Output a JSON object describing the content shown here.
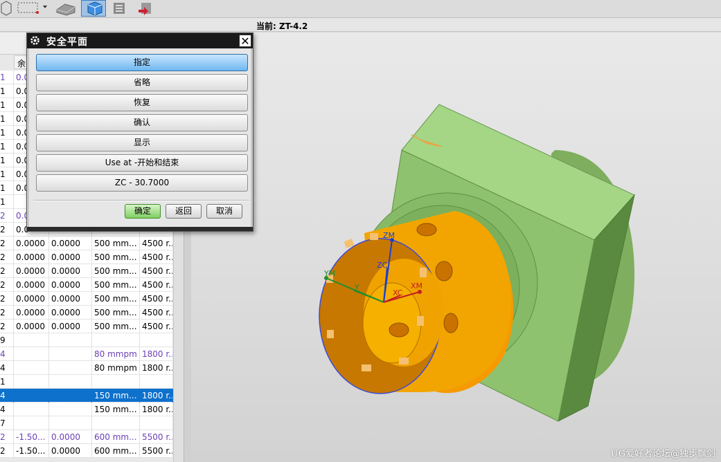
{
  "status": {
    "current_label": "当前: ZT-4.2"
  },
  "navigator": {
    "column_header": "余",
    "rows": [
      {
        "c0": "1",
        "c1": "0.0",
        "c2": "",
        "c3": "",
        "c4": "",
        "style": "purple"
      },
      {
        "c0": "1",
        "c1": "0.0",
        "c2": "",
        "c3": "",
        "c4": "",
        "style": ""
      },
      {
        "c0": "1",
        "c1": "0.0",
        "c2": "",
        "c3": "",
        "c4": "",
        "style": ""
      },
      {
        "c0": "1",
        "c1": "0.0",
        "c2": "",
        "c3": "",
        "c4": "",
        "style": ""
      },
      {
        "c0": "1",
        "c1": "0.0",
        "c2": "",
        "c3": "",
        "c4": "",
        "style": ""
      },
      {
        "c0": "1",
        "c1": "0.0",
        "c2": "",
        "c3": "",
        "c4": "",
        "style": ""
      },
      {
        "c0": "1",
        "c1": "0.0",
        "c2": "",
        "c3": "",
        "c4": "",
        "style": ""
      },
      {
        "c0": "1",
        "c1": "0.0",
        "c2": "",
        "c3": "",
        "c4": "",
        "style": ""
      },
      {
        "c0": "1",
        "c1": "0.0",
        "c2": "",
        "c3": "",
        "c4": "",
        "style": ""
      },
      {
        "c0": "1",
        "c1": "",
        "c2": "",
        "c3": "",
        "c4": "",
        "style": ""
      },
      {
        "c0": "2",
        "c1": "0.0",
        "c2": "",
        "c3": "",
        "c4": "",
        "style": "purple"
      },
      {
        "c0": "2",
        "c1": "0.0",
        "c2": "",
        "c3": "",
        "c4": "",
        "style": ""
      },
      {
        "c0": "2",
        "c1": "0.0000",
        "c2": "0.0000",
        "c3": "500 mm...",
        "c4": "4500 r...",
        "style": ""
      },
      {
        "c0": "2",
        "c1": "0.0000",
        "c2": "0.0000",
        "c3": "500 mm...",
        "c4": "4500 r...",
        "style": ""
      },
      {
        "c0": "2",
        "c1": "0.0000",
        "c2": "0.0000",
        "c3": "500 mm...",
        "c4": "4500 r...",
        "style": ""
      },
      {
        "c0": "2",
        "c1": "0.0000",
        "c2": "0.0000",
        "c3": "500 mm...",
        "c4": "4500 r...",
        "style": ""
      },
      {
        "c0": "2",
        "c1": "0.0000",
        "c2": "0.0000",
        "c3": "500 mm...",
        "c4": "4500 r...",
        "style": ""
      },
      {
        "c0": "2",
        "c1": "0.0000",
        "c2": "0.0000",
        "c3": "500 mm...",
        "c4": "4500 r...",
        "style": ""
      },
      {
        "c0": "2",
        "c1": "0.0000",
        "c2": "0.0000",
        "c3": "500 mm...",
        "c4": "4500 r...",
        "style": ""
      },
      {
        "c0": "9",
        "c1": "",
        "c2": "",
        "c3": "",
        "c4": "",
        "style": ""
      },
      {
        "c0": "4",
        "c1": "",
        "c2": "",
        "c3": "80 mmpm",
        "c4": "1800 r...",
        "style": "purple"
      },
      {
        "c0": "4",
        "c1": "",
        "c2": "",
        "c3": "80 mmpm",
        "c4": "1800 r...",
        "style": ""
      },
      {
        "c0": "1",
        "c1": "",
        "c2": "",
        "c3": "",
        "c4": "",
        "style": ""
      },
      {
        "c0": "4",
        "c1": "",
        "c2": "",
        "c3": "150 mm...",
        "c4": "1800 r...",
        "style": "sel"
      },
      {
        "c0": "4",
        "c1": "",
        "c2": "",
        "c3": "150 mm...",
        "c4": "1800 r...",
        "style": ""
      },
      {
        "c0": "7",
        "c1": "",
        "c2": "",
        "c3": "",
        "c4": "",
        "style": ""
      },
      {
        "c0": "2",
        "c1": "-1.50...",
        "c2": "0.0000",
        "c3": "600 mm...",
        "c4": "5500 r...",
        "style": "purple"
      },
      {
        "c0": "2",
        "c1": "-1.50...",
        "c2": "0.0000",
        "c3": "600 mm...",
        "c4": "5500 r...",
        "style": ""
      }
    ]
  },
  "dialog": {
    "title": "安全平面",
    "close_glyph": "✕",
    "options": [
      "指定",
      "省略",
      "恢复",
      "确认",
      "显示",
      "Use at -开始和结束",
      "ZC - 30.7000"
    ],
    "ok_label": "确定",
    "back_label": "返回",
    "cancel_label": "取消"
  },
  "viewport": {
    "axis_labels": {
      "zm": "ZM",
      "zc": "ZC",
      "ym": "YM",
      "yc": "Y",
      "xc": "XC",
      "xm": "XM"
    },
    "watermark": "UG爱好者论坛@独步飘剑"
  },
  "colors": {
    "part_green": "#a8d98a",
    "part_orange": "#f5a300",
    "selection": "#0e71cc",
    "dialog_title": "#1a1a1a"
  }
}
